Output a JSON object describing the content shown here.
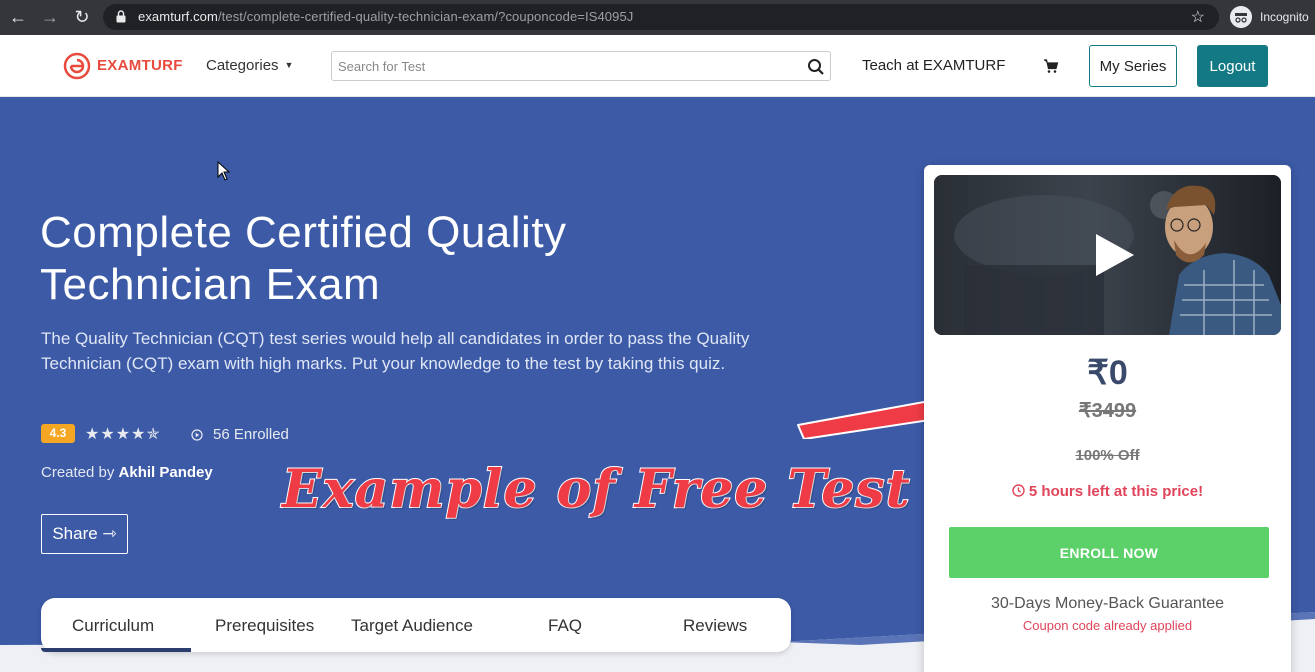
{
  "browser": {
    "url_host": "examturf.com",
    "url_path": "/test/complete-certified-quality-technician-exam/?couponcode=IS4095J",
    "incognito_label": "Incognito"
  },
  "header": {
    "logo_text": "EXAMTURF",
    "categories_label": "Categories",
    "search_placeholder": "Search for Test",
    "teach_label": "Teach at EXAMTURF",
    "my_series_label": "My Series",
    "logout_label": "Logout"
  },
  "course": {
    "title": "Complete Certified Quality Technician Exam",
    "description": "The Quality Technician (CQT) test series would help all candidates in order to pass the Quality Technician (CQT) exam with high marks. Put your knowledge to the test by taking this quiz.",
    "rating": "4.3",
    "rating_value": 4.3,
    "stars": "★★★★✯",
    "enrolled": "56 Enrolled",
    "created_by_label": "Created by",
    "author": "Akhil Pandey",
    "share_label": "Share ⇾"
  },
  "overlay": {
    "text": "Example of Free Test",
    "color": "#ef3b45"
  },
  "tabs": [
    {
      "label": "Curriculum"
    },
    {
      "label": "Prerequisites"
    },
    {
      "label": "Target Audience"
    },
    {
      "label": "FAQ"
    },
    {
      "label": "Reviews"
    }
  ],
  "card": {
    "price": "₹0",
    "old_price": "₹3499",
    "discount": "100% Off",
    "timer": "5 hours left at this price!",
    "enroll_label": "ENROLL NOW",
    "guarantee": "30-Days Money-Back Guarantee",
    "coupon": "Coupon code already applied"
  },
  "colors": {
    "hero_bg": "#3c5aa6",
    "accent_teal": "#137a85",
    "enroll_green": "#5cd16a",
    "alert_red": "#e0445a"
  }
}
